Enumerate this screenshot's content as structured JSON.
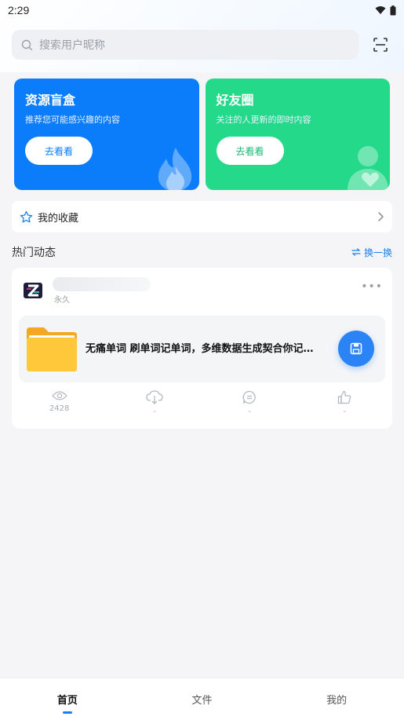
{
  "status_bar": {
    "time": "2:29"
  },
  "search": {
    "placeholder": "搜索用户昵称"
  },
  "promo_cards": [
    {
      "title": "资源盲盒",
      "subtitle": "推荐您可能感兴趣的内容",
      "button": "去看看",
      "color": "#0b7dfb"
    },
    {
      "title": "好友圈",
      "subtitle": "关注的人更新的即时内容",
      "button": "去看看",
      "color": "#25d98a"
    }
  ],
  "favorites": {
    "label": "我的收藏"
  },
  "hot_section": {
    "title": "热门动态",
    "refresh_label": "换一换"
  },
  "post": {
    "meta": "永久",
    "file_name": "无痛单词 刷单词记单词，多维数据生成契合你记…",
    "stats": [
      {
        "icon": "eye-icon",
        "value": "2428"
      },
      {
        "icon": "download-icon",
        "value": "-"
      },
      {
        "icon": "comment-icon",
        "value": "-"
      },
      {
        "icon": "thumbs-up-icon",
        "value": "-"
      }
    ]
  },
  "bottom_nav": [
    {
      "label": "首页",
      "active": true
    },
    {
      "label": "文件",
      "active": false
    },
    {
      "label": "我的",
      "active": false
    }
  ],
  "colors": {
    "accent": "#1a7ff0",
    "blue_card": "#0b7dfb",
    "green_card": "#25d98a"
  }
}
